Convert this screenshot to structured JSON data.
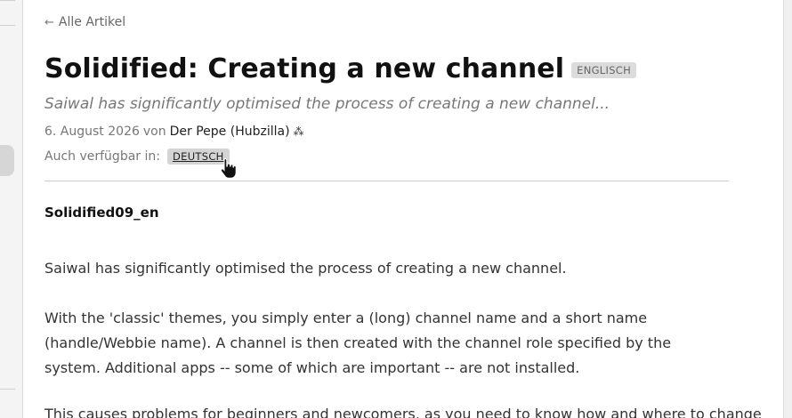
{
  "nav": {
    "back_label": "Alle Artikel"
  },
  "article": {
    "title": "Solidified: Creating a new channel",
    "language_badge": "ENGLISCH",
    "subtitle": "Saiwal has significantly optimised the process of creating a new channel...",
    "date": "6. August 2026",
    "by_word": "von",
    "author": "Der Pepe (Hubzilla)",
    "author_icon": "fediverse-stars-icon",
    "available_label": "Auch verfügbar in:",
    "available_language": "DEUTSCH",
    "heading": "Solidified09_en",
    "paragraphs": [
      "Saiwal has significantly optimised the process of creating a new channel.",
      "With the 'classic' themes, you simply enter a (long) channel name and a short name (handle/Webbie name). A channel is then created with the channel role specified by the system. Additional apps -- some of which are important -- are not installed.",
      "This causes problems for beginners and newcomers, as you need to know how and where to change"
    ]
  },
  "colors": {
    "badge_bg": "#dcdcdc",
    "text": "#333333",
    "muted": "#777777"
  }
}
